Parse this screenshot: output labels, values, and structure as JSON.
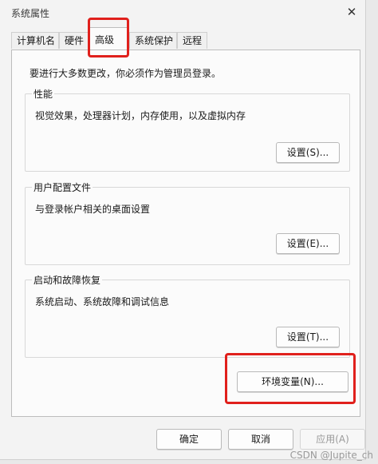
{
  "window": {
    "title": "系统属性",
    "close_glyph": "✕"
  },
  "tabs": [
    {
      "label": "计算机名"
    },
    {
      "label": "硬件"
    },
    {
      "label": "高级",
      "active": true
    },
    {
      "label": "系统保护"
    },
    {
      "label": "远程"
    }
  ],
  "notice": "要进行大多数更改，你必须作为管理员登录。",
  "groups": {
    "performance": {
      "label": "性能",
      "desc": "视觉效果，处理器计划，内存使用，以及虚拟内存",
      "button": "设置(S)..."
    },
    "profile": {
      "label": "用户配置文件",
      "desc": "与登录帐户相关的桌面设置",
      "button": "设置(E)..."
    },
    "startup": {
      "label": "启动和故障恢复",
      "desc": "系统启动、系统故障和调试信息",
      "button": "设置(T)..."
    }
  },
  "env_button": "环境变量(N)...",
  "footer": {
    "ok": "确定",
    "cancel": "取消",
    "apply": "应用(A)"
  },
  "watermark": "CSDN @Jupite_ch",
  "colors": {
    "highlight": "#e0201c"
  }
}
